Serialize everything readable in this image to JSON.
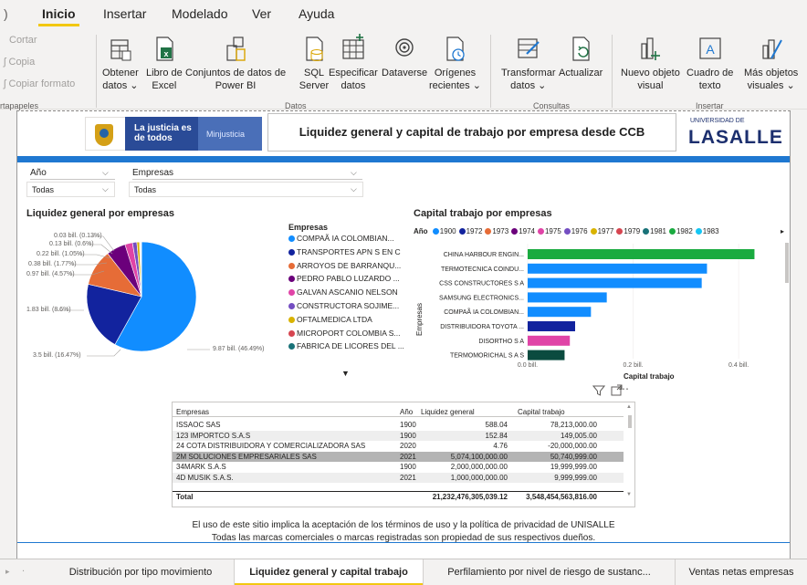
{
  "menu": {
    "left_glyph": ")",
    "tabs": [
      "Inicio",
      "Insertar",
      "Modelado",
      "Ver",
      "Ayuda"
    ]
  },
  "ribbon": {
    "clipboard": {
      "cut": "Cortar",
      "copy": "Copia",
      "format": "Copiar formato",
      "group": "rtapapeles"
    },
    "buttons": [
      {
        "line1": "Obtener",
        "line2": "datos ⌄",
        "icon": "database-icon"
      },
      {
        "line1": "Libro de",
        "line2": "Excel",
        "icon": "excel-icon"
      },
      {
        "line1": "Conjuntos de datos de",
        "line2": "Power BI",
        "icon": "dataset-icon"
      },
      {
        "line1": "SQL",
        "line2": "Server",
        "icon": "sql-server-icon"
      },
      {
        "line1": "Especificar",
        "line2": "datos",
        "icon": "table-icon"
      },
      {
        "line1": "Dataverse",
        "line2": "",
        "icon": "dataverse-icon"
      },
      {
        "line1": "Orígenes",
        "line2": "recientes ⌄",
        "icon": "recent-sources-icon"
      },
      {
        "line1": "Transformar",
        "line2": "datos ⌄",
        "icon": "transform-icon"
      },
      {
        "line1": "Actualizar",
        "line2": "",
        "icon": "refresh-icon"
      },
      {
        "line1": "Nuevo objeto",
        "line2": "visual",
        "icon": "new-visual-icon"
      },
      {
        "line1": "Cuadro de",
        "line2": "texto",
        "icon": "text-box-icon"
      },
      {
        "line1": "Más objetos",
        "line2": "visuales ⌄",
        "icon": "more-visuals-icon"
      }
    ],
    "groups": {
      "datos": "Datos",
      "consultas": "Consultas",
      "insertar": "Insertar"
    }
  },
  "header": {
    "justicia": "La justicia es de todos",
    "minjusticia": "Minjusticia",
    "title": "Liquidez general y capital de trabajo por empresa desde CCB",
    "univ_small": "UNIVERSIDAD DE",
    "univ": "LASALLE"
  },
  "slicers": {
    "year": {
      "label": "Año",
      "value": "Todas"
    },
    "company": {
      "label": "Empresas",
      "value": "Todas"
    }
  },
  "pie": {
    "title": "Liquidez general por empresas",
    "legend_title": "Empresas",
    "legend": [
      {
        "name": "COMPAÃ IA COLOMBIAN...",
        "color": "#118DFF"
      },
      {
        "name": "TRANSPORTES APN S EN C",
        "color": "#12239E"
      },
      {
        "name": "ARROYOS DE BARRANQU...",
        "color": "#E66C37"
      },
      {
        "name": "PEDRO PABLO LUZARDO ...",
        "color": "#6B007B"
      },
      {
        "name": "GALVAN ASCANIO NELSON",
        "color": "#E044A7"
      },
      {
        "name": "CONSTRUCTORA SOJIME...",
        "color": "#744EC2"
      },
      {
        "name": "OFTALMEDICA LTDA",
        "color": "#D9B300"
      },
      {
        "name": "MICROPORT COLOMBIA S...",
        "color": "#D64550"
      },
      {
        "name": "FABRICA DE LICORES DEL ...",
        "color": "#197278"
      }
    ],
    "labels": [
      "0.03 bill. (0.13%)",
      "0.13 bill. (0.6%)",
      "0.22 bill. (1.05%)",
      "0.38 bill. (1.77%)",
      "0.97 bill. (4.57%)",
      "1.83 bill. (8.6%)",
      "3.5 bill. (16.47%)",
      "9.87 bill. (46.49%)"
    ]
  },
  "bar": {
    "title": "Capital trabajo por empresas",
    "legend_label": "Año",
    "years": [
      {
        "y": "1900",
        "color": "#118DFF"
      },
      {
        "y": "1972",
        "color": "#12239E"
      },
      {
        "y": "1973",
        "color": "#E66C37"
      },
      {
        "y": "1974",
        "color": "#6B007B"
      },
      {
        "y": "1975",
        "color": "#E044A7"
      },
      {
        "y": "1976",
        "color": "#744EC2"
      },
      {
        "y": "1977",
        "color": "#D9B300"
      },
      {
        "y": "1979",
        "color": "#D64550"
      },
      {
        "y": "1981",
        "color": "#197278"
      },
      {
        "y": "1982",
        "color": "#1AAB40"
      },
      {
        "y": "1983",
        "color": "#15C6F4"
      }
    ],
    "y_title": "Empresas",
    "x_title": "Capital trabajo"
  },
  "chart_data": {
    "type": "bar",
    "title": "Capital trabajo por empresas",
    "xlabel": "Capital trabajo",
    "ylabel": "Empresas",
    "orientation": "horizontal",
    "xlim": [
      0,
      0.45
    ],
    "x_ticks": [
      "0.0 bill.",
      "0.2 bill.",
      "0.4 bill."
    ],
    "categories": [
      "CHINA HARBOUR ENGIN...",
      "TERMOTECNICA COINDU...",
      "CSS CONSTRUCTORES S A",
      "SAMSUNG ELECTRONICS...",
      "COMPAÃ IA COLOMBIAN...",
      "DISTRIBUIDORA TOYOTA ...",
      "DISORTHO S A",
      "TERMOMORICHAL S A S"
    ],
    "values": [
      0.43,
      0.34,
      0.33,
      0.15,
      0.12,
      0.09,
      0.08,
      0.07
    ],
    "colors": [
      "#1AAB40",
      "#118DFF",
      "#118DFF",
      "#118DFF",
      "#118DFF",
      "#12239E",
      "#E044A7",
      "#0B4B3F"
    ],
    "legend_position": "top"
  },
  "pie_chart_data": {
    "type": "pie",
    "values": [
      9.87,
      3.5,
      1.83,
      0.97,
      0.38,
      0.22,
      0.13,
      0.03,
      0.02,
      0.02,
      0.02,
      0.01
    ],
    "colors": [
      "#118DFF",
      "#12239E",
      "#E66C37",
      "#6B007B",
      "#E044A7",
      "#744EC2",
      "#D9B300",
      "#D64550",
      "#197278",
      "#1AAB40",
      "#15C6F4",
      "#4092FF"
    ]
  },
  "table": {
    "headers": [
      "Empresas",
      "Año",
      "Liquidez general",
      "Capital trabajo"
    ],
    "rows": [
      [
        "ISSAOC SAS",
        "1900",
        "588.04",
        "78,213,000.00"
      ],
      [
        "123 IMPORTCO S.A.S",
        "1900",
        "152.84",
        "149,005.00"
      ],
      [
        "24 COTA DISTRIBUIDORA Y COMERCIALIZADORA SAS",
        "2020",
        "4.76",
        "-20,000,000.00"
      ],
      [
        "2M SOLUCIONES EMPRESARIALES SAS",
        "2021",
        "5,074,100,000.00",
        "50,740,999.00"
      ],
      [
        "34MARK S.A.S",
        "1900",
        "2,000,000,000.00",
        "19,999,999.00"
      ],
      [
        "4D MUSIK S.A.S.",
        "2021",
        "1,000,000,000.00",
        "9,999,999.00"
      ]
    ],
    "total": [
      "Total",
      "",
      "21,232,476,305,039.12",
      "3,548,454,563,816.00"
    ]
  },
  "footer": {
    "line1": "El uso de este sitio implica la aceptación de los términos de uso y la política de privacidad de UNISALLE",
    "line2": "Todas las marcas comerciales o marcas registradas son propiedad de sus respectivos dueños."
  },
  "page_tabs": [
    "Distribución por tipo movimiento",
    "Liquidez general y capital trabajo",
    "Perfilamiento por nivel de riesgo de sustanc...",
    "Ventas netas empresas"
  ]
}
